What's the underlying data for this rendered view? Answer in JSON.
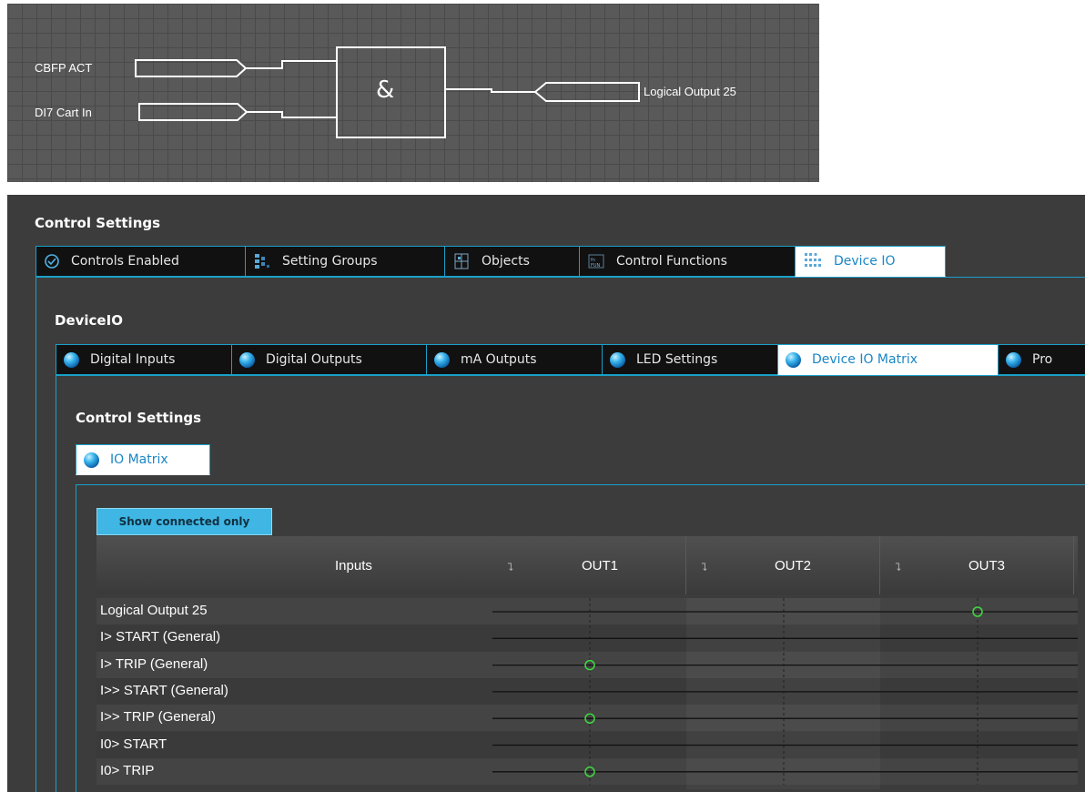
{
  "diagram": {
    "input1": "CBFP ACT",
    "input2": "DI7 Cart In",
    "gate_symbol": "&",
    "output": "Logical Output 25"
  },
  "panel": {
    "title": "Control Settings",
    "tabs": [
      {
        "label": "Controls Enabled",
        "icon": "check-circle-icon"
      },
      {
        "label": "Setting Groups",
        "icon": "setting-groups-icon"
      },
      {
        "label": "Objects",
        "icon": "objects-icon"
      },
      {
        "label": "Control Functions",
        "icon": "control-functions-icon"
      },
      {
        "label": "Device IO",
        "icon": "device-io-icon",
        "active": true
      }
    ],
    "subtitle": "DeviceIO",
    "subtabs": [
      {
        "label": "Digital Inputs"
      },
      {
        "label": "Digital Outputs"
      },
      {
        "label": "mA Outputs"
      },
      {
        "label": "LED Settings"
      },
      {
        "label": "Device IO Matrix",
        "active": true
      },
      {
        "label": "Pro"
      }
    ],
    "inner_title": "Control Settings",
    "inner_tab": "IO Matrix",
    "show_connected_button": "Show connected only",
    "matrix": {
      "inputs_header": "Inputs",
      "columns": [
        "OUT1",
        "OUT2",
        "OUT3"
      ],
      "rows": [
        {
          "label": "Logical Output 25",
          "connected": [
            false,
            false,
            true
          ]
        },
        {
          "label": "I> START (General)",
          "connected": [
            false,
            false,
            false
          ]
        },
        {
          "label": "I> TRIP (General)",
          "connected": [
            true,
            false,
            false
          ]
        },
        {
          "label": "I>> START (General)",
          "connected": [
            false,
            false,
            false
          ]
        },
        {
          "label": "I>> TRIP (General)",
          "connected": [
            true,
            false,
            false
          ]
        },
        {
          "label": "I0> START",
          "connected": [
            false,
            false,
            false
          ]
        },
        {
          "label": "I0> TRIP",
          "connected": [
            true,
            false,
            false
          ]
        }
      ]
    }
  },
  "colors": {
    "accent": "#1aa0c8",
    "connection": "#3ddc3d",
    "active_tab_text": "#1a86c4"
  }
}
